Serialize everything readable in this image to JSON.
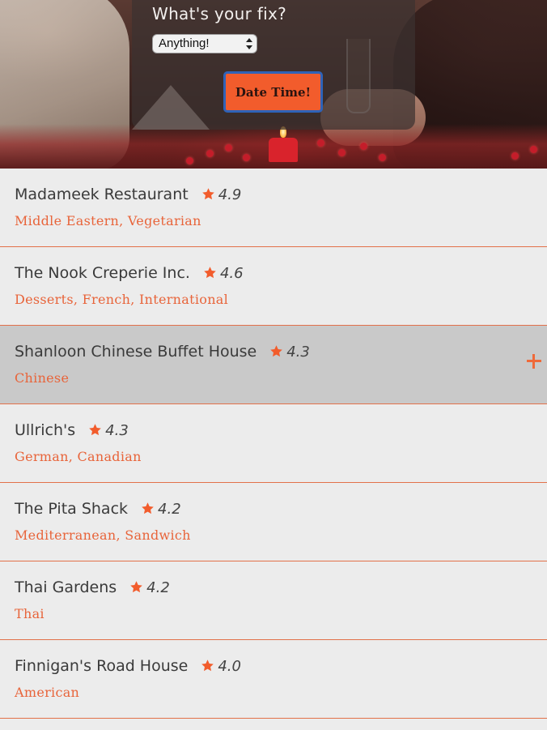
{
  "hero": {
    "prompt_label": "What's your fix?",
    "select_value": "Anything!",
    "button_label": "Date Time!"
  },
  "colors": {
    "accent": "#f25c2c",
    "cuisine_text": "#e8643a",
    "row_hover_bg": "#c9c9c9",
    "row_bg": "#ececec"
  },
  "restaurants": [
    {
      "name": "Madameek Restaurant",
      "rating": "4.9",
      "cuisines": "Middle Eastern, Vegetarian",
      "hovered": false
    },
    {
      "name": "The Nook Creperie Inc.",
      "rating": "4.6",
      "cuisines": "Desserts, French, International",
      "hovered": false
    },
    {
      "name": "Shanloon Chinese Buffet House",
      "rating": "4.3",
      "cuisines": "Chinese",
      "hovered": true
    },
    {
      "name": "Ullrich's",
      "rating": "4.3",
      "cuisines": "German, Canadian",
      "hovered": false
    },
    {
      "name": "The Pita Shack",
      "rating": "4.2",
      "cuisines": "Mediterranean, Sandwich",
      "hovered": false
    },
    {
      "name": "Thai Gardens",
      "rating": "4.2",
      "cuisines": "Thai",
      "hovered": false
    },
    {
      "name": "Finnigan's Road House",
      "rating": "4.0",
      "cuisines": "American",
      "hovered": false
    }
  ],
  "icons": {
    "rating": "star-icon",
    "expand": "plus-icon"
  }
}
